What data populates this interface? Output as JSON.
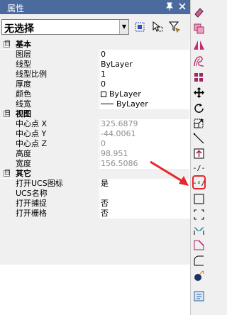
{
  "panel": {
    "title": "属性",
    "pin_icon": "pin-icon",
    "close_icon": "close-icon"
  },
  "selection": {
    "value": "无选择"
  },
  "grid": {
    "categories": [
      {
        "label": "基本",
        "expanded_glyph": "日",
        "rows": [
          {
            "name": "图层",
            "value": "0",
            "readonly": false
          },
          {
            "name": "线型",
            "value": "ByLayer",
            "readonly": false
          },
          {
            "name": "线型比例",
            "value": "1",
            "readonly": false
          },
          {
            "name": "厚度",
            "value": "0",
            "readonly": false
          },
          {
            "name": "颜色",
            "value": "ByLayer",
            "readonly": false,
            "swatch": true
          },
          {
            "name": "线宽",
            "value": "ByLayer",
            "readonly": false,
            "lineweight": true
          }
        ]
      },
      {
        "label": "视图",
        "expanded_glyph": "日",
        "rows": [
          {
            "name": "中心点 X",
            "value": "325.6879",
            "readonly": true
          },
          {
            "name": "中心点 Y",
            "value": "-44.0061",
            "readonly": true
          },
          {
            "name": "中心点 Z",
            "value": "0",
            "readonly": true
          },
          {
            "name": "高度",
            "value": "98.951",
            "readonly": true
          },
          {
            "name": "宽度",
            "value": "156.5086",
            "readonly": true
          }
        ]
      },
      {
        "label": "其它",
        "expanded_glyph": "日",
        "rows": [
          {
            "name": "打开UCS图标",
            "value": "是",
            "readonly": false
          },
          {
            "name": "UCS名称",
            "value": "",
            "readonly": false
          },
          {
            "name": "打开捕捉",
            "value": "否",
            "readonly": false
          },
          {
            "name": "打开栅格",
            "value": "否",
            "readonly": false
          }
        ]
      }
    ]
  },
  "toolbar": {
    "dash_labels": [
      "-/--",
      "--/"
    ]
  },
  "colors": {
    "title_bar": "#4b6b9e",
    "highlight": "#e8262b"
  }
}
